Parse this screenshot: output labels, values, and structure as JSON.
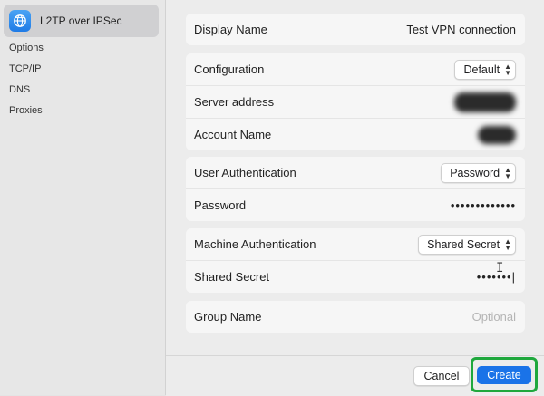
{
  "sidebar": {
    "selected": {
      "label": "L2TP over IPSec",
      "icon": "globe-network-icon"
    },
    "items": [
      {
        "label": "Options"
      },
      {
        "label": "TCP/IP"
      },
      {
        "label": "DNS"
      },
      {
        "label": "Proxies"
      }
    ]
  },
  "form": {
    "display_name": {
      "label": "Display Name",
      "value": "Test VPN connection"
    },
    "configuration": {
      "label": "Configuration",
      "value": "Default"
    },
    "server_address": {
      "label": "Server address"
    },
    "account_name": {
      "label": "Account Name"
    },
    "user_auth": {
      "label": "User Authentication",
      "value": "Password"
    },
    "password": {
      "label": "Password",
      "value": "•••••••••••••"
    },
    "machine_auth": {
      "label": "Machine Authentication",
      "value": "Shared Secret"
    },
    "shared_secret": {
      "label": "Shared Secret",
      "value": "•••••••|"
    },
    "group_name": {
      "label": "Group Name",
      "placeholder": "Optional"
    }
  },
  "footer": {
    "cancel_label": "Cancel",
    "create_label": "Create"
  },
  "colors": {
    "accent": "#1a73e8",
    "highlight": "#1fa83d"
  }
}
